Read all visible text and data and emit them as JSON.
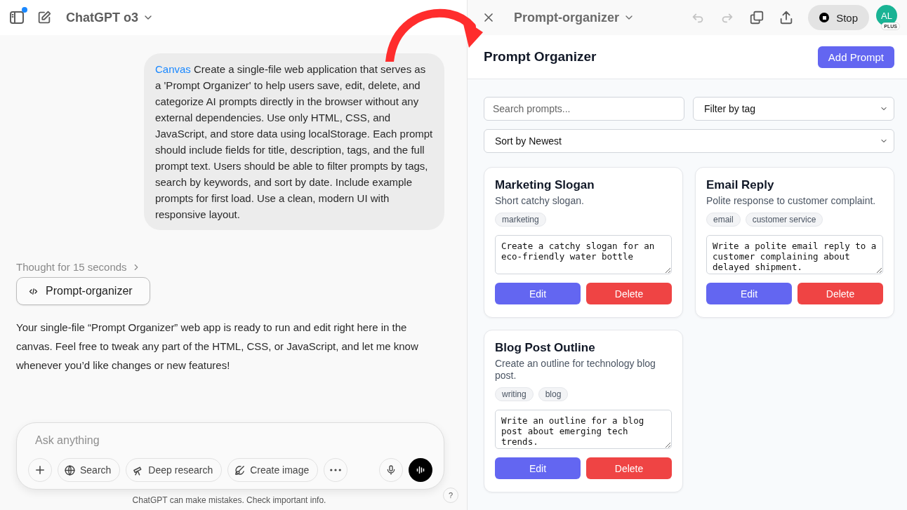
{
  "chat_header": {
    "model": "ChatGPT o3"
  },
  "user_message": {
    "tag": "Canvas",
    "text": "Create a single-file web application that serves as a 'Prompt Organizer' to help users save, edit, delete, and categorize AI prompts directly in the browser without any external dependencies. Use only HTML, CSS, and JavaScript, and store data using localStorage. Each prompt should include fields for title, description, tags, and the full prompt text. Users should be able to filter prompts by tags, search by keywords, and sort by date. Include example prompts for first load. Use a clean, modern UI with responsive layout."
  },
  "thought": {
    "label": "Thought for 15 seconds"
  },
  "canvas_chip": {
    "label": "Prompt-organizer"
  },
  "assistant_message": "Your single-file “Prompt Organizer” web app is ready to run and edit right here in the canvas. Feel free to tweak any part of the HTML, CSS, or JavaScript, and let me know whenever you’d like changes or new features!",
  "composer": {
    "placeholder": "Ask anything",
    "tools": [
      {
        "kind": "globe",
        "label": "Search"
      },
      {
        "kind": "telescope",
        "label": "Deep research"
      },
      {
        "kind": "brush",
        "label": "Create image"
      }
    ]
  },
  "disclaimer": "ChatGPT can make mistakes. Check important info.",
  "help": "?",
  "canvas_header": {
    "title": "Prompt-organizer",
    "stop": "Stop",
    "avatar": "AL",
    "plan": "PLUS"
  },
  "app": {
    "title": "Prompt Organizer",
    "add_button": "Add Prompt",
    "search_placeholder": "Search prompts...",
    "filter": "Filter by tag",
    "sort": "Sort by Newest",
    "cards": [
      {
        "title": "Marketing Slogan",
        "description": "Short catchy slogan.",
        "tags": [
          "marketing"
        ],
        "prompt": "Create a catchy slogan for an eco-friendly water bottle",
        "edit": "Edit",
        "delete": "Delete"
      },
      {
        "title": "Email Reply",
        "description": "Polite response to customer complaint.",
        "tags": [
          "email",
          "customer service"
        ],
        "prompt": "Write a polite email reply to a customer complaining about delayed shipment.",
        "edit": "Edit",
        "delete": "Delete"
      },
      {
        "title": "Blog Post Outline",
        "description": "Create an outline for technology blog post.",
        "tags": [
          "writing",
          "blog"
        ],
        "prompt": "Write an outline for a blog post about emerging tech trends.",
        "edit": "Edit",
        "delete": "Delete"
      }
    ]
  }
}
